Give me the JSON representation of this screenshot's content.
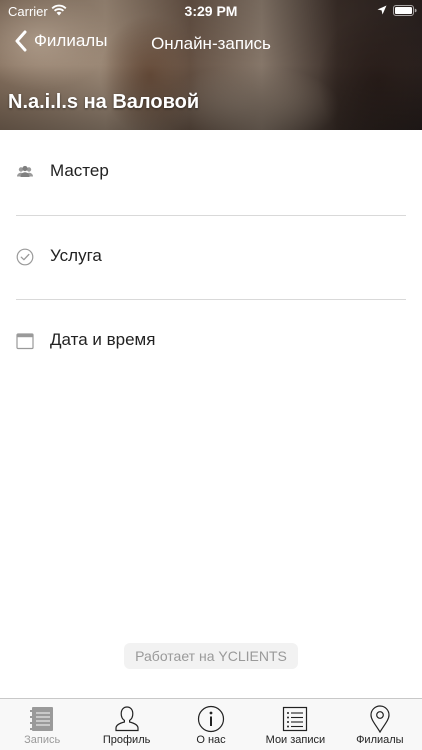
{
  "status_bar": {
    "carrier": "Carrier",
    "time": "3:29 PM",
    "wifi_icon": "wifi-icon",
    "location_icon": "location-arrow-icon",
    "battery_icon": "battery-icon"
  },
  "nav": {
    "back_label": "Филиалы",
    "title": "Онлайн-запись",
    "back_icon": "chevron-left-icon"
  },
  "branch": {
    "name": "N.a.i.l.s на Валовой"
  },
  "menu": {
    "items": [
      {
        "label": "Мастер",
        "icon": "people-icon"
      },
      {
        "label": "Услуга",
        "icon": "check-circle-icon"
      },
      {
        "label": "Дата и время",
        "icon": "calendar-icon"
      }
    ]
  },
  "footer": {
    "powered_by": "Работает на YCLIENTS"
  },
  "tab_bar": {
    "active_tab": "Запись",
    "tabs": [
      {
        "label": "Запись",
        "icon": "notebook-icon"
      },
      {
        "label": "Профиль",
        "icon": "person-icon"
      },
      {
        "label": "О нас",
        "icon": "info-icon"
      },
      {
        "label": "Мои записи",
        "icon": "list-icon"
      },
      {
        "label": "Филиалы",
        "icon": "map-pin-icon"
      }
    ]
  },
  "colors": {
    "text": "#222222",
    "icon_gray": "#9a9a9a",
    "divider": "#d9d9d9",
    "tab_bar_bg": "#f8f8f8",
    "badge_bg": "#f2f2f2"
  }
}
